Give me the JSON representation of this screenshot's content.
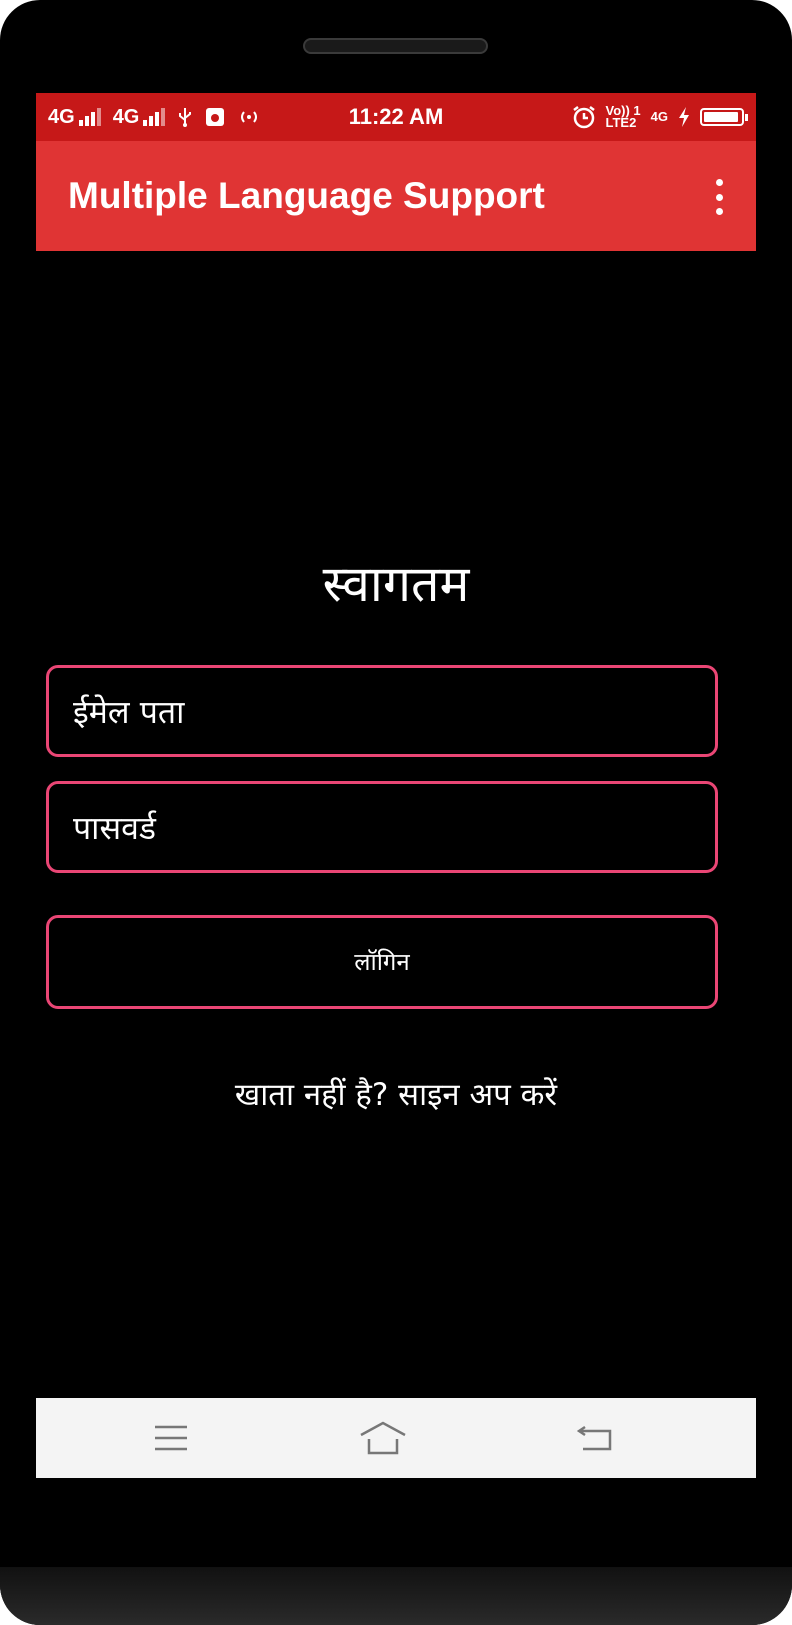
{
  "status_bar": {
    "network_1": "4G",
    "network_2": "4G",
    "time": "11:22 AM",
    "volte_top": "Vo)) 1",
    "volte_bottom": "LTE2",
    "net_small": "4G",
    "battery_level": 0.95
  },
  "app_bar": {
    "title": "Multiple Language Support"
  },
  "login": {
    "welcome": "स्वागतम",
    "email_placeholder": "ईमेल पता",
    "password_placeholder": "पासवर्ड",
    "login_label": "लॉगिन",
    "signup_prompt": "खाता नहीं है? साइन अप करें"
  },
  "colors": {
    "status_bar": "#c61818",
    "app_bar": "#e03434",
    "accent_border": "#ea4675",
    "background": "#000000"
  },
  "icons": [
    "signal-icon",
    "usb-icon",
    "app-notification-icon",
    "hotspot-icon",
    "alarm-icon",
    "charging-icon",
    "battery-icon",
    "more-options-icon",
    "menu-icon",
    "home-icon",
    "back-icon"
  ]
}
